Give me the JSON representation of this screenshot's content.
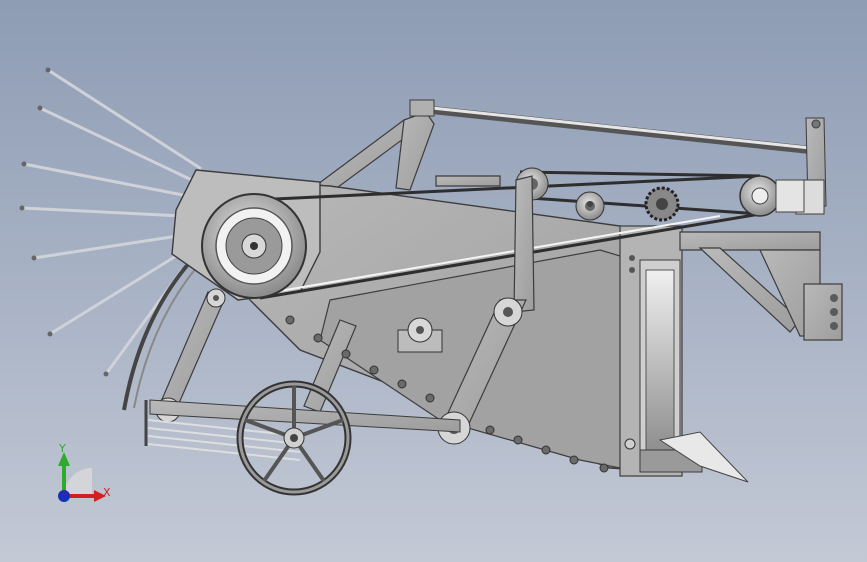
{
  "viewport": {
    "background_top": "#8e9cb4",
    "background_bottom": "#c3c9d5"
  },
  "model": {
    "subject": "harvester-mechanism-side-view",
    "body_color": "#a9a9a9",
    "edge_color": "#3c3c3c",
    "belt_color": "#2e2e2e"
  },
  "triad": {
    "y_label": "Y",
    "x_label": "X",
    "y_color": "#2faa2f",
    "x_color": "#d02020",
    "z_color": "#1a2fb8"
  }
}
